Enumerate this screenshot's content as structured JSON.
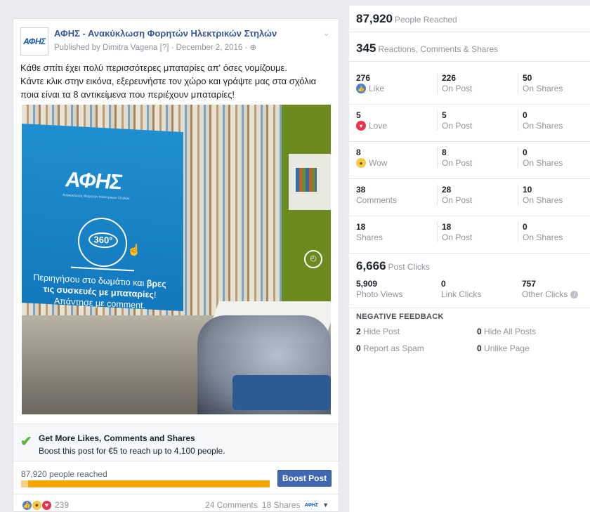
{
  "post": {
    "logo_text": "ΑΦΗΣ",
    "page_name": "ΑΦΗΣ - Ανακύκλωση Φορητών Ηλεκτρικών Στηλών",
    "meta": "Published by Dimitra Vagena [?] · December 2, 2016 · ",
    "globe_icon": "globe-icon",
    "text_lines": [
      "Κάθε σπίτι έχει πολύ περισσότερες μπαταρίες απ' όσες νομίζουμε.",
      "Κάντε κλικ στην εικόνα, εξερευνήστε τον χώρο και γράψτε μας στα σχόλια",
      "ποια είναι τα 8 αντικείμενα που περιέχουν μπαταρίες!"
    ],
    "image": {
      "banner_logo": "ΑΦΗΣ",
      "banner_sub": "Ανακύκλωση Φορητών Ηλεκτρικών Στηλών",
      "pano_label": "360°",
      "line1": "Περιηγήσου στο δωμάτιο και ",
      "line1_bold": "βρες",
      "line2_bold": "τις συσκευές με μπαταρίες",
      "line2_end": "!",
      "line3": "Απάντησε με comment."
    },
    "boost": {
      "title": "Get More Likes, Comments and Shares",
      "desc": "Boost this post for €5 to reach up to 4,100 people."
    },
    "reach_label": "87,920 people reached",
    "reach_progress": 1.0,
    "boost_button": "Boost Post",
    "reaction_count": "239",
    "comments": "24 Comments",
    "shares": "18 Shares",
    "mini_logo": "ΑΦΗΣ"
  },
  "insights": {
    "people_reached": {
      "num": "87,920",
      "label": "People Reached"
    },
    "engagement": {
      "num": "345",
      "label": "Reactions, Comments & Shares"
    },
    "rows": [
      {
        "total": "276",
        "label": "Like",
        "icon": "like-icon",
        "on_post": "226",
        "on_shares": "50"
      },
      {
        "total": "5",
        "label": "Love",
        "icon": "love-icon",
        "on_post": "5",
        "on_shares": "0"
      },
      {
        "total": "8",
        "label": "Wow",
        "icon": "wow-icon",
        "on_post": "8",
        "on_shares": "0"
      },
      {
        "total": "38",
        "label": "Comments",
        "icon": "",
        "on_post": "28",
        "on_shares": "10"
      },
      {
        "total": "18",
        "label": "Shares",
        "icon": "",
        "on_post": "18",
        "on_shares": "0"
      }
    ],
    "on_post_label": "On Post",
    "on_shares_label": "On Shares",
    "post_clicks": {
      "num": "6,666",
      "label": "Post Clicks"
    },
    "clicks": [
      {
        "num": "5,909",
        "label": "Photo Views"
      },
      {
        "num": "0",
        "label": "Link Clicks"
      },
      {
        "num": "757",
        "label": "Other Clicks"
      }
    ],
    "negative": {
      "title": "NEGATIVE FEEDBACK",
      "hide_post": {
        "num": "2",
        "label": "Hide Post"
      },
      "hide_all": {
        "num": "0",
        "label": "Hide All Posts"
      },
      "spam": {
        "num": "0",
        "label": "Report as Spam"
      },
      "unlike": {
        "num": "0",
        "label": "Unlike Page"
      }
    }
  }
}
